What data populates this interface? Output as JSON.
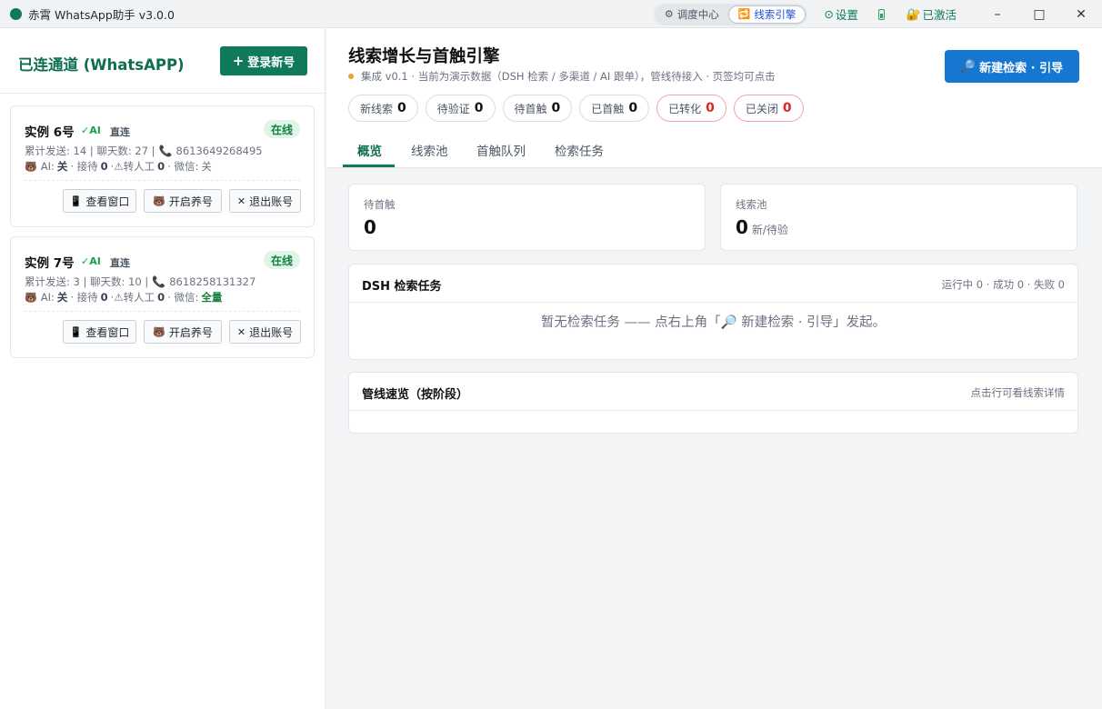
{
  "app": {
    "title": "赤霄 WhatsApp助手 v3.0.0"
  },
  "titlebar": {
    "seg_tabs": [
      {
        "icon": "⚙",
        "label": "调度中心",
        "active": false
      },
      {
        "icon": "🔁",
        "label": "线索引擎",
        "active": true
      }
    ],
    "settings_label": "设置",
    "activated_label": "已激活",
    "window_controls": {
      "minimize": "–",
      "maximize": "□",
      "close": "✕"
    }
  },
  "left": {
    "title": "已连通道 (WhatsAPP)",
    "add_button": "登录新号",
    "cards": [
      {
        "name": "实例 6号",
        "ai": "✓AI",
        "mode": "直连",
        "status": "在线",
        "stats": "累计发送: 14 | 聊天数: 27 |",
        "phone": "8613649268495",
        "ai_label": "AI:",
        "ai_value": "关",
        "reception_label": "· 接待",
        "reception_value": "0",
        "manual_label": "·⚠转人工",
        "manual_value": "0",
        "wechat_label": "· 微信:",
        "wechat_value": "关",
        "buttons": [
          "查看窗口",
          "开启养号",
          "退出账号"
        ]
      },
      {
        "name": "实例 7号",
        "ai": "✓AI",
        "mode": "直连",
        "status": "在线",
        "stats": "累计发送: 3 | 聊天数: 10 |",
        "phone": "8618258131327",
        "ai_label": "AI:",
        "ai_value": "关",
        "reception_label": "· 接待",
        "reception_value": "0",
        "manual_label": "·⚠转人工",
        "manual_value": "0",
        "wechat_label": "· 微信:",
        "wechat_value": "全量",
        "buttons": [
          "查看窗口",
          "开启养号",
          "退出账号"
        ]
      }
    ]
  },
  "main": {
    "title": "线索增长与首触引擎",
    "subtitle": "集成 v0.1 · 当前为演示数据（DSH 检索 / 多渠道 / AI 跟单），管线待接入 · 页签均可点击",
    "new_search_button": "新建检索 · 引导",
    "chips": [
      {
        "label": "新线索",
        "value": "0",
        "alert": false
      },
      {
        "label": "待验证",
        "value": "0",
        "alert": false
      },
      {
        "label": "待首触",
        "value": "0",
        "alert": false
      },
      {
        "label": "已首触",
        "value": "0",
        "alert": false
      },
      {
        "label": "已转化",
        "value": "0",
        "alert": true
      },
      {
        "label": "已关闭",
        "value": "0",
        "alert": true
      }
    ],
    "tabs": [
      "概览",
      "线索池",
      "首触队列",
      "检索任务"
    ],
    "stats": [
      {
        "label": "待首触",
        "value": "0",
        "suffix": ""
      },
      {
        "label": "线索池",
        "value": "0",
        "suffix": "新/待验"
      }
    ],
    "dsh_panel": {
      "title": "DSH 检索任务",
      "meta": "运行中 0 · 成功 0 · 失败 0",
      "empty": "暂无检索任务 —— 点右上角「🔎 新建检索 · 引导」发起。"
    },
    "pipeline_panel": {
      "title": "管线速览（按阶段）",
      "meta": "点击行可看线索详情"
    }
  },
  "colors": {
    "brand_green": "#0f7a5a",
    "primary_blue": "#1677d2",
    "alert_red": "#dc2626",
    "status_orange": "#f0a030"
  }
}
